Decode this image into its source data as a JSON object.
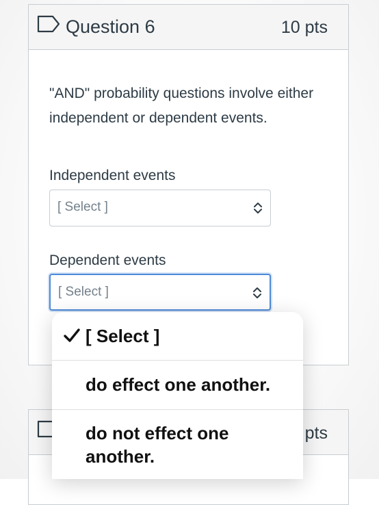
{
  "question": {
    "title": "Question 6",
    "points": "10 pts",
    "text": "\"AND\" probability questions involve either independent or dependent events.",
    "items": [
      {
        "label": "Independent events",
        "selected": "[ Select ]"
      },
      {
        "label": "Dependent events",
        "selected": "[ Select ]"
      }
    ]
  },
  "dropdown": {
    "options": [
      {
        "label": "[ Select ]",
        "checked": true
      },
      {
        "label": "do effect one another.",
        "checked": false
      },
      {
        "label": "do not effect one another.",
        "checked": false
      }
    ]
  },
  "next_question": {
    "points_partial": "pts"
  },
  "colors": {
    "focus_border": "#4d8ad8",
    "header_bg": "#f5f5f5",
    "text": "#2d3b45",
    "placeholder": "#73818c"
  },
  "icons": {
    "flag": "flag-outline-icon",
    "select_arrows": "up-down-arrows-icon",
    "check": "checkmark-icon"
  }
}
